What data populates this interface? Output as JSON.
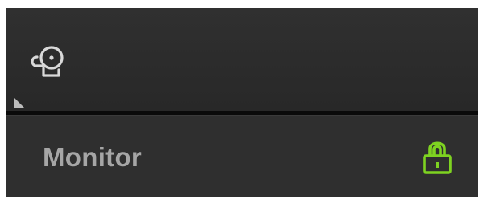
{
  "header": {
    "icon": "alarm-bell-icon",
    "corner_indicator": "corner-triangle-icon"
  },
  "row": {
    "label": "Monitor",
    "lock_icon": "lock-icon",
    "lock_color": "#7ed321"
  },
  "colors": {
    "panel_bg": "#2e2e2e",
    "label_text": "#a6a6a6",
    "icon_stroke": "#d9d9d9"
  }
}
